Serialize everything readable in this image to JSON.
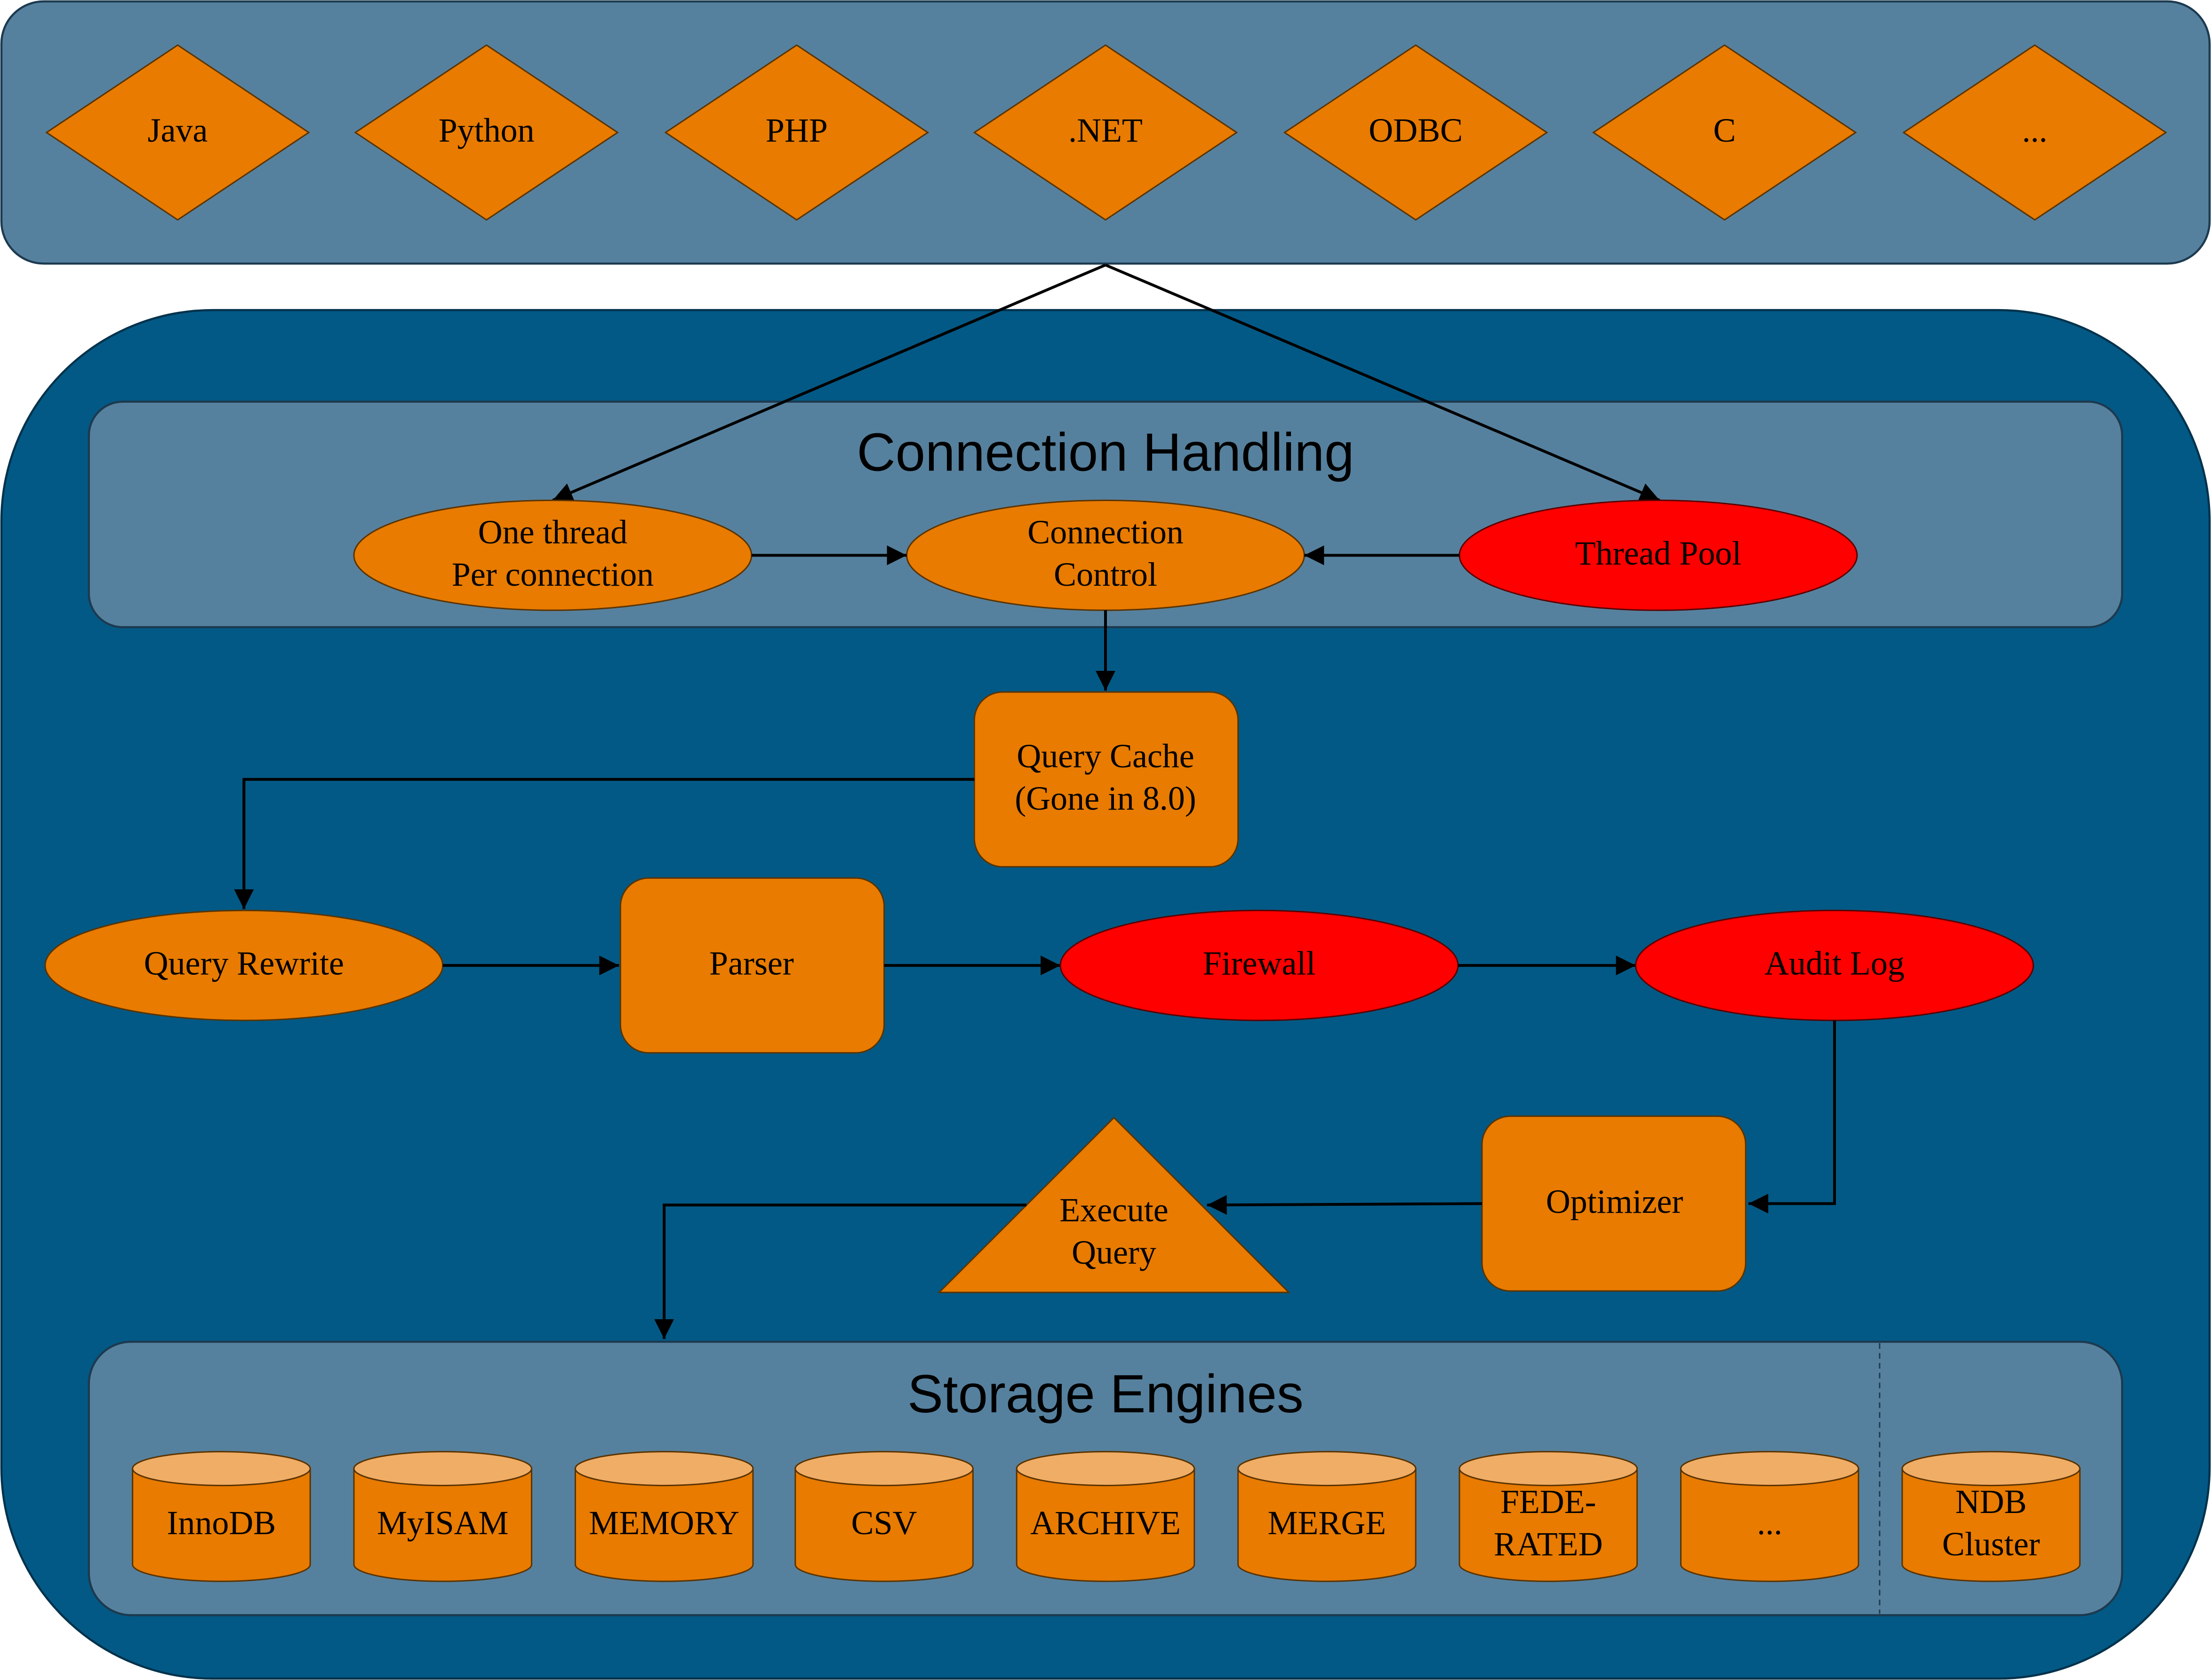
{
  "colors": {
    "outer_panel": "#56819e",
    "inner_panel": "#035985",
    "node_default": "#e87b00",
    "node_highlight": "#ff0000",
    "cylinder_top": "#f0ad66",
    "edge": "#000000"
  },
  "connectors": {
    "items": [
      "Java",
      "Python",
      "PHP",
      ".NET",
      "ODBC",
      "C",
      "..."
    ]
  },
  "connection_handling": {
    "title": "Connection Handling",
    "one_thread": [
      "One thread",
      "Per connection"
    ],
    "connection_control": [
      "Connection",
      "Control"
    ],
    "thread_pool": "Thread Pool"
  },
  "query_cache": [
    "Query Cache",
    "(Gone in 8.0)"
  ],
  "pipeline": {
    "query_rewrite": "Query Rewrite",
    "parser": "Parser",
    "firewall": "Firewall",
    "audit_log": "Audit Log",
    "optimizer": "Optimizer",
    "execute_query": [
      "Execute",
      "Query"
    ]
  },
  "storage_engines": {
    "title": "Storage Engines",
    "items": [
      [
        "InnoDB"
      ],
      [
        "MyISAM"
      ],
      [
        "MEMORY"
      ],
      [
        "CSV"
      ],
      [
        "ARCHIVE"
      ],
      [
        "MERGE"
      ],
      [
        "FEDE-",
        "RATED"
      ],
      [
        "..."
      ]
    ],
    "separate": [
      "NDB",
      "Cluster"
    ]
  }
}
